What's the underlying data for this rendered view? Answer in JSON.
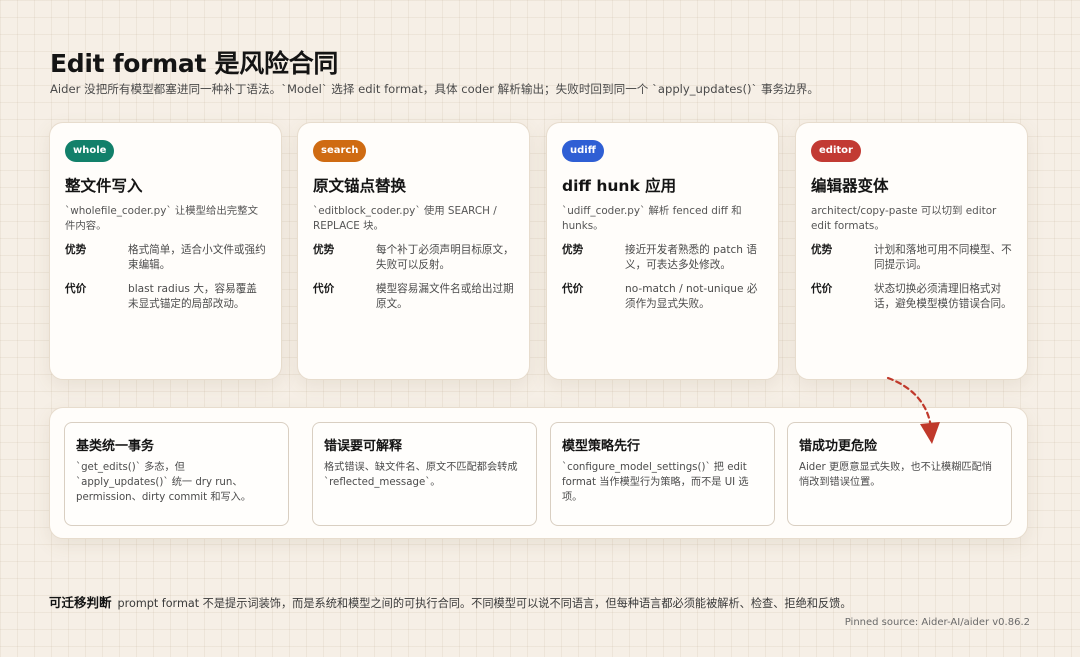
{
  "header": {
    "title": "Edit format 是风险合同",
    "subtitle": "Aider 没把所有模型都塞进同一种补丁语法。`Model` 选择 edit format，具体 coder 解析输出；失败时回到同一个 `apply_updates()` 事务边界。"
  },
  "colors": {
    "whole": "#12806a",
    "search": "#cf6b12",
    "udiff": "#2f5fd4",
    "editor": "#c23a33",
    "arrow": "#c0392b"
  },
  "cards": [
    {
      "tag": "whole",
      "title": "整文件写入",
      "desc": "`wholefile_coder.py` 让模型给出完整文件内容。",
      "pro_label": "优势",
      "pro": "格式简单，适合小文件或强约束编辑。",
      "cost_label": "代价",
      "cost": "blast radius 大，容易覆盖未显式锚定的局部改动。"
    },
    {
      "tag": "search",
      "title": "原文锚点替换",
      "desc": "`editblock_coder.py` 使用 SEARCH / REPLACE 块。",
      "pro_label": "优势",
      "pro": "每个补丁必须声明目标原文，失败可以反射。",
      "cost_label": "代价",
      "cost": "模型容易漏文件名或给出过期原文。"
    },
    {
      "tag": "udiff",
      "title": "diff hunk 应用",
      "desc": "`udiff_coder.py` 解析 fenced diff 和 hunks。",
      "pro_label": "优势",
      "pro": "接近开发者熟悉的 patch 语义，可表达多处修改。",
      "cost_label": "代价",
      "cost": "no-match / not-unique 必须作为显式失败。"
    },
    {
      "tag": "editor",
      "title": "编辑器变体",
      "desc": "architect/copy-paste 可以切到 editor edit formats。",
      "pro_label": "优势",
      "pro": "计划和落地可用不同模型、不同提示词。",
      "cost_label": "代价",
      "cost": "状态切换必须清理旧格式对话，避免模型模仿错误合同。"
    }
  ],
  "principles": [
    {
      "title": "基类统一事务",
      "desc": "`get_edits()` 多态，但 `apply_updates()` 统一 dry run、permission、dirty commit 和写入。"
    },
    {
      "title": "错误要可解释",
      "desc": "格式错误、缺文件名、原文不匹配都会转成 `reflected_message`。"
    },
    {
      "title": "模型策略先行",
      "desc": "`configure_model_settings()` 把 edit format 当作模型行为策略，而不是 UI 选项。"
    },
    {
      "title": "错成功更危险",
      "desc": "Aider 更愿意显式失败，也不让模糊匹配悄悄改到错误位置。"
    }
  ],
  "footer": {
    "label": "可迁移判断",
    "text": "prompt format 不是提示词装饰，而是系统和模型之间的可执行合同。不同模型可以说不同语言，但每种语言都必须能被解析、检查、拒绝和反馈。",
    "source": "Pinned source: Aider-AI/aider v0.86.2"
  }
}
